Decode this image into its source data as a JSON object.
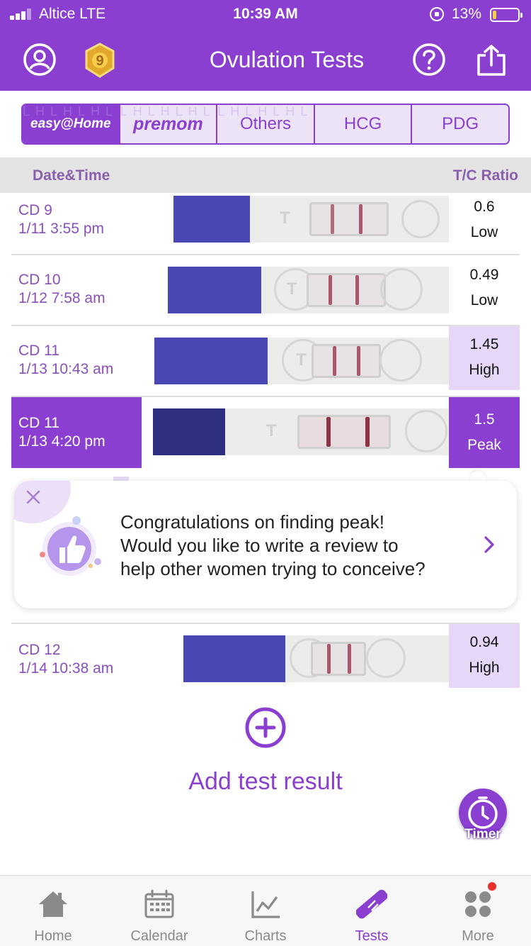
{
  "status_bar": {
    "carrier": "Altice  LTE",
    "time": "10:39 AM",
    "battery": "13%"
  },
  "header": {
    "title": "Ovulation Tests",
    "badge_number": "9"
  },
  "brand_tabs": [
    {
      "label": "easy@Home",
      "active": true
    },
    {
      "label": "premom",
      "active": false
    },
    {
      "label": "Others",
      "active": false
    },
    {
      "label": "HCG",
      "active": false
    },
    {
      "label": "PDG",
      "active": false
    }
  ],
  "columns": {
    "left": "Date&Time",
    "right": "T/C Ratio"
  },
  "tests": [
    {
      "cd": "CD 9",
      "datetime": "1/11 3:55 pm",
      "ratio": "0.6",
      "level": "Low"
    },
    {
      "cd": "CD 10",
      "datetime": "1/12 7:58 am",
      "ratio": "0.49",
      "level": "Low"
    },
    {
      "cd": "CD 11",
      "datetime": "1/13 10:43 am",
      "ratio": "1.45",
      "level": "High"
    },
    {
      "cd": "CD 11",
      "datetime": "1/13 4:20 pm",
      "ratio": "1.5",
      "level": "Peak"
    },
    {
      "cd": "CD 12",
      "datetime": "1/14 10:38 am",
      "ratio": "0.94",
      "level": "High"
    }
  ],
  "review_card": {
    "line1": "Congratulations on finding peak!",
    "line2": "Would you like to write a review to",
    "line3": "help other women trying to conceive?"
  },
  "add_test": {
    "label": "Add test result"
  },
  "timer": {
    "label": "Timer"
  },
  "tabbar": [
    {
      "label": "Home",
      "icon": "home-icon"
    },
    {
      "label": "Calendar",
      "icon": "calendar-icon"
    },
    {
      "label": "Charts",
      "icon": "chart-icon"
    },
    {
      "label": "Tests",
      "icon": "test-strip-icon",
      "active": true
    },
    {
      "label": "More",
      "icon": "more-icon"
    }
  ],
  "colors": {
    "accent": "#8a3fd0",
    "high_bg": "#e6d6f8",
    "notification": "#e8302c"
  }
}
